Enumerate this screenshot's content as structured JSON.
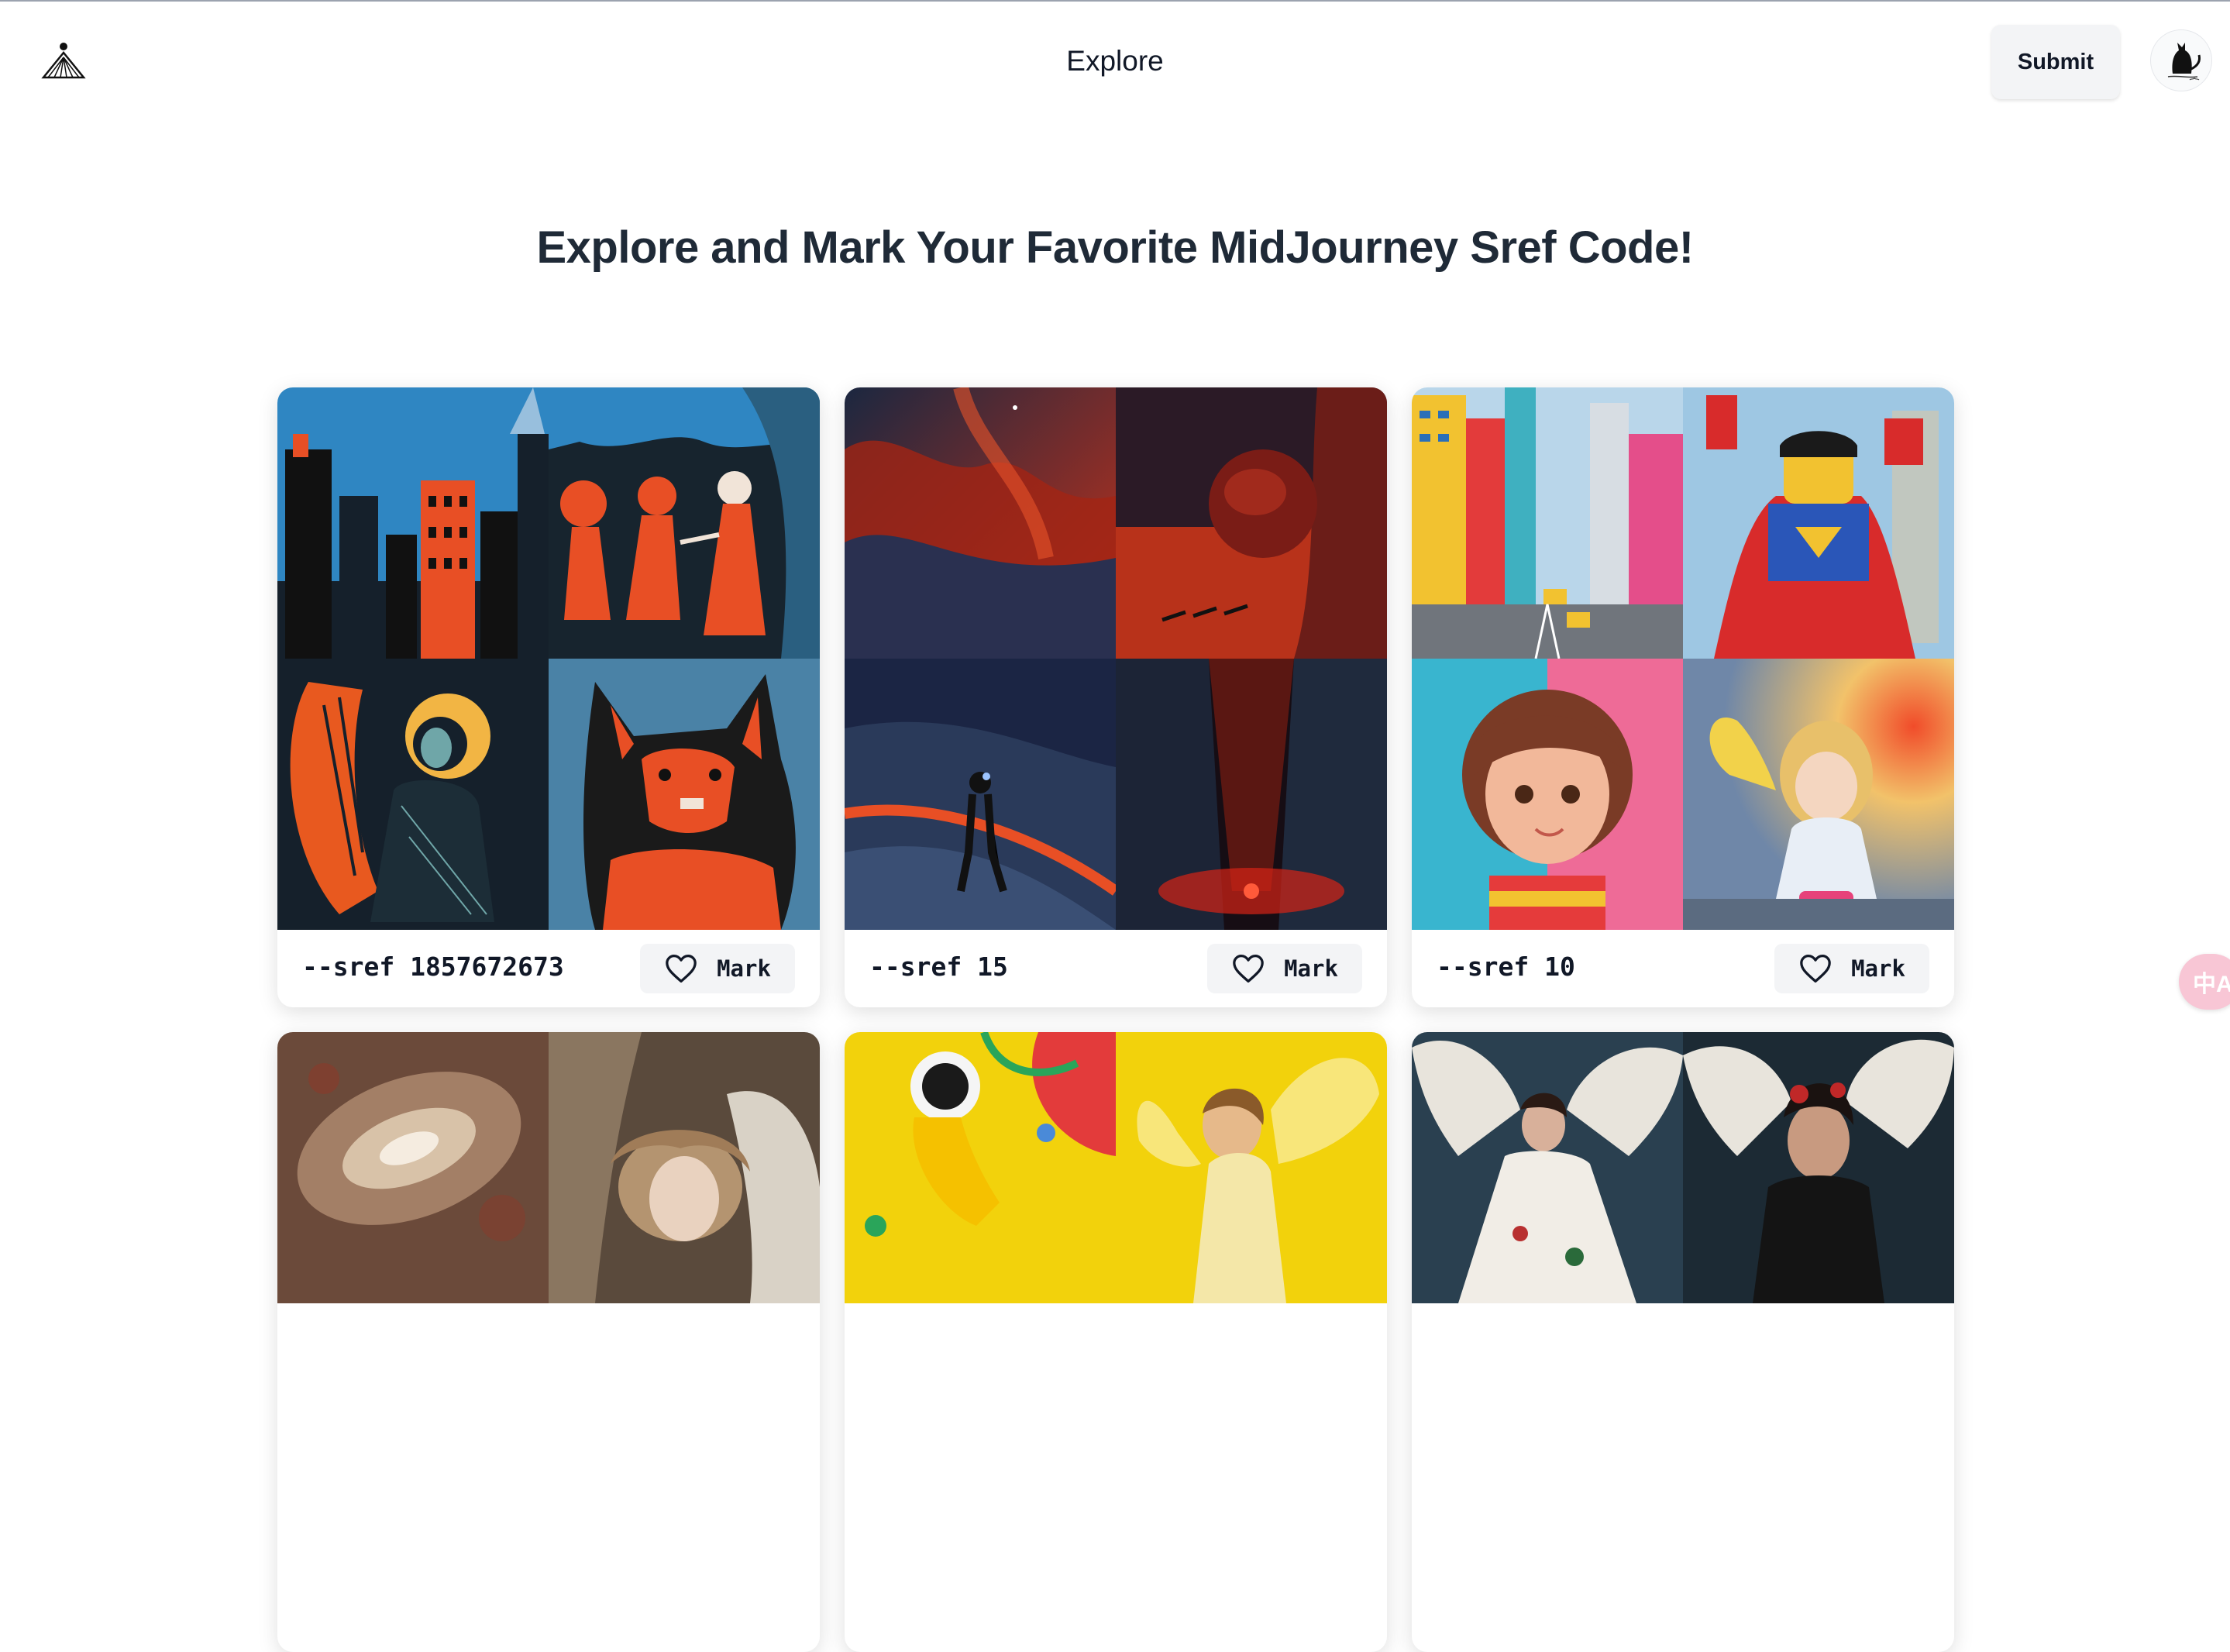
{
  "header": {
    "logo_icon": "pyramid-logo-icon",
    "title": "Explore",
    "submit_label": "Submit",
    "avatar_icon": "cat-avatar-icon"
  },
  "headline": "Explore and Mark Your Favorite MidJourney Sref Code!",
  "cards": [
    {
      "code": "--sref 1857672673",
      "mark_label": "Mark",
      "images": [
        "city-skyline",
        "dancers-scene",
        "angel-praying",
        "dog-howling"
      ]
    },
    {
      "code": "--sref 15",
      "mark_label": "Mark",
      "images": [
        "red-cloudscape",
        "floating-sphere",
        "astronaut-walking",
        "red-city-canyon"
      ]
    },
    {
      "code": "--sref 10",
      "mark_label": "Mark",
      "images": [
        "lego-city",
        "lego-superman",
        "toy-girl",
        "angel-figurine"
      ]
    },
    {
      "code": "",
      "mark_label": "",
      "images": [
        "galaxy-swirl",
        "baroque-woman"
      ]
    },
    {
      "code": "",
      "mark_label": "",
      "images": [
        "yellow-astronaut",
        "yellow-angel"
      ]
    },
    {
      "code": "",
      "mark_label": "",
      "images": [
        "winged-dancer",
        "winged-woman"
      ]
    }
  ],
  "translate_button": {
    "label": "中A",
    "icon": "translate-icon"
  },
  "colors": {
    "page_bg": "#ffffff",
    "button_bg": "#f3f4f6",
    "headline": "#1f2a37",
    "fab_bg": "#f8c6d5"
  }
}
